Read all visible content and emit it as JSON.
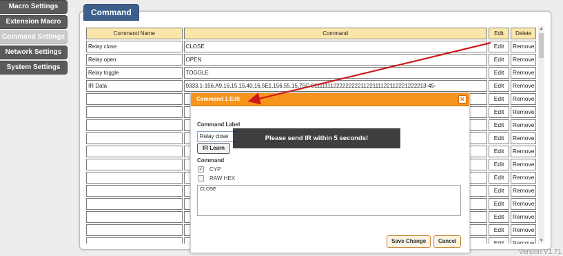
{
  "sidebar": {
    "items": [
      {
        "label": "Macro Settings"
      },
      {
        "label": "Extension Macro"
      },
      {
        "label": "Command Settings"
      },
      {
        "label": "Network Settings"
      },
      {
        "label": "System Settings"
      }
    ]
  },
  "panel": {
    "title": "Command"
  },
  "table": {
    "headers": [
      "Command Name",
      "Command",
      "Edit",
      "Delete"
    ],
    "rows": [
      {
        "name": "Relay close",
        "command": "CLOSE"
      },
      {
        "name": "Relay open",
        "command": "OPEN"
      },
      {
        "name": "Relay toggle",
        "command": "TOGGLE"
      },
      {
        "name": "IR Data",
        "command": "9333,1-156,A9,16,15,15,40,16,5E1,156,55,15,75C-011111112222222221122111122112221222213-45-"
      },
      {
        "name": "",
        "command": ""
      },
      {
        "name": "",
        "command": ""
      },
      {
        "name": "",
        "command": ""
      },
      {
        "name": "",
        "command": ""
      },
      {
        "name": "",
        "command": ""
      },
      {
        "name": "",
        "command": ""
      },
      {
        "name": "",
        "command": ""
      },
      {
        "name": "",
        "command": ""
      },
      {
        "name": "",
        "command": ""
      },
      {
        "name": "",
        "command": ""
      },
      {
        "name": "",
        "command": ""
      },
      {
        "name": "",
        "command": ""
      },
      {
        "name": "",
        "command": ""
      }
    ],
    "edit_label": "Edit",
    "remove_label": "Remove"
  },
  "modal": {
    "title": "Command 1 Edit",
    "command_label_heading": "Command Label",
    "label_value": "Relay close",
    "ir_learn_label": "IR Learn",
    "command_heading": "Command",
    "option_cyp": "CYP",
    "option_raw": "RAW HEX",
    "command_value": "CLOSE",
    "save_label": "Save Change",
    "cancel_label": "Cancel"
  },
  "toast": {
    "message": "Please send IR within 5 seconds!"
  },
  "footer": {
    "version": "Version V1.71"
  },
  "colors": {
    "accent_header": "#3d5f8c",
    "modal_header": "#f7941d",
    "table_header": "#f9e6a8",
    "arrow": "#cc1a1a"
  }
}
